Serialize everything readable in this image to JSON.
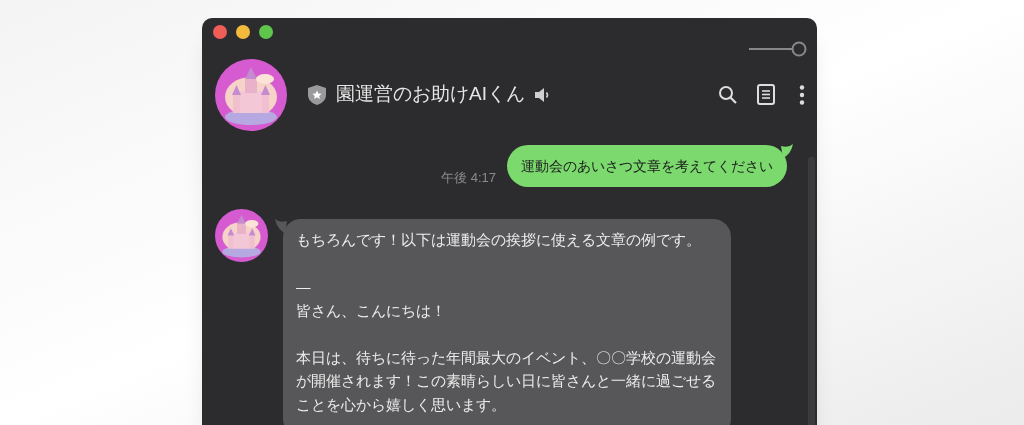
{
  "window": {
    "title": "園運営のお助けAIくん"
  },
  "messages": [
    {
      "kind": "sent",
      "text": "運動会のあいさつ文章を考えてください",
      "time": "午後 4:17"
    },
    {
      "kind": "received",
      "blocks": [
        [
          "もちろんです！以下は運動会の挨拶に使える文章の例です。"
        ],
        [
          "—",
          "皆さん、こんにちは！"
        ],
        [
          "本日は、待ちに待った年間最大のイベント、〇〇学校の運動会が開催されます！この素晴らしい日に皆さんと一緒に過ごせることを心から嬉しく思います。"
        ]
      ]
    }
  ]
}
